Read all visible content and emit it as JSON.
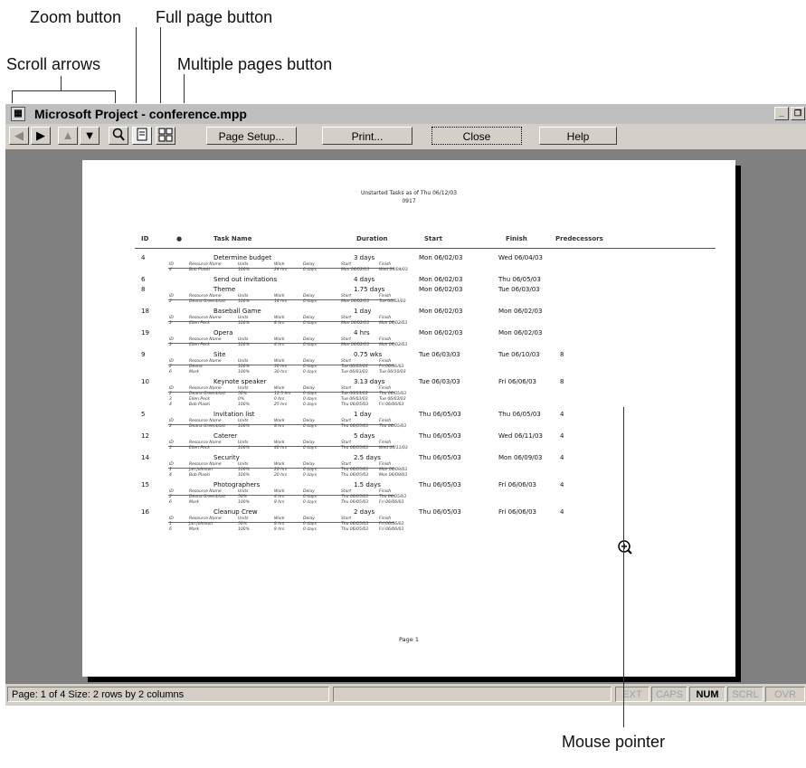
{
  "callouts": {
    "zoom": "Zoom button",
    "full_page": "Full page button",
    "scroll": "Scroll arrows",
    "multiple": "Multiple pages button",
    "mouse": "Mouse pointer"
  },
  "window": {
    "title": "Microsoft Project - conference.mpp",
    "app_icon": "project-icon",
    "controls": [
      "minimize-icon",
      "restore-icon",
      "close-icon"
    ]
  },
  "toolbar": {
    "icons": [
      "scroll-left-icon",
      "scroll-right-icon",
      "scroll-up-icon",
      "scroll-down-icon",
      "zoom-icon",
      "full-page-icon",
      "multiple-pages-icon"
    ],
    "page_setup": "Page Setup...",
    "print": "Print...",
    "close": "Close",
    "help": "Help"
  },
  "report": {
    "title_line1": "Unstarted Tasks as of Thu 06/12/03",
    "title_line2": "0917",
    "headers": {
      "id": "ID",
      "task_name": "Task Name",
      "duration": "Duration",
      "start": "Start",
      "finish": "Finish",
      "predecessors": "Predecessors"
    },
    "sub_headers": [
      "ID",
      "Resource Name",
      "Units",
      "Work",
      "Delay",
      "Start",
      "Finish"
    ],
    "tasks": [
      {
        "id": "4",
        "name": "Determine budget",
        "duration": "3 days",
        "start": "Mon 06/02/03",
        "finish": "Wed 06/04/03",
        "pred": "",
        "assign": [
          [
            "4",
            "Bob Plaski",
            "100%",
            "24 hrs",
            "0 days",
            "Mon 06/02/03",
            "Wed 06/04/03"
          ]
        ]
      },
      {
        "id": "6",
        "name": "Send out invitations",
        "duration": "4 days",
        "start": "Mon 06/02/03",
        "finish": "Thu 06/05/03",
        "pred": "",
        "assign": []
      },
      {
        "id": "8",
        "name": "Theme",
        "duration": "1.75 days",
        "start": "Mon 06/02/03",
        "finish": "Tue 06/03/03",
        "pred": "",
        "assign": [
          [
            "2",
            "Deana Greenblatt",
            "100%",
            "14 hrs",
            "0 days",
            "Mon 06/02/03",
            "Tue 06/03/03"
          ]
        ]
      },
      {
        "id": "18",
        "name": "Baseball Game",
        "duration": "1 day",
        "start": "Mon 06/02/03",
        "finish": "Mon 06/02/03",
        "pred": "",
        "assign": [
          [
            "3",
            "Ellen Peck",
            "100%",
            "8 hrs",
            "0 days",
            "Mon 06/02/03",
            "Mon 06/02/03"
          ]
        ]
      },
      {
        "id": "19",
        "name": "Opera",
        "duration": "4 hrs",
        "start": "Mon 06/02/03",
        "finish": "Mon 06/02/03",
        "pred": "",
        "assign": [
          [
            "3",
            "Ellen Peck",
            "100%",
            "4 hrs",
            "0 days",
            "Mon 06/02/03",
            "Mon 06/02/03"
          ]
        ]
      },
      {
        "id": "9",
        "name": "Site",
        "duration": "0.75 wks",
        "start": "Tue 06/03/03",
        "finish": "Tue 06/10/03",
        "pred": "8",
        "assign": [
          [
            "2",
            "Deana",
            "100%",
            "30 hrs",
            "0 days",
            "Tue 06/03/03",
            "Fri 06/06/03"
          ],
          [
            "6",
            "Mark",
            "100%",
            "30 hrs",
            "0 days",
            "Tue 06/03/03",
            "Tue 06/10/03"
          ]
        ]
      },
      {
        "id": "10",
        "name": "Keynote speaker",
        "duration": "3.13 days",
        "start": "Tue 06/03/03",
        "finish": "Fri 06/06/03",
        "pred": "8",
        "assign": [
          [
            "2",
            "Deana Greenblatt",
            "50%",
            "12.5 hrs",
            "0 days",
            "Tue 06/03/03",
            "Thu 06/05/03"
          ],
          [
            "3",
            "Ellen Peck",
            "0%",
            "0 hrs",
            "0 days",
            "Tue 06/03/03",
            "Tue 06/03/03"
          ],
          [
            "4",
            "Bob Plaski",
            "100%",
            "25 hrs",
            "0 days",
            "Thu 06/05/03",
            "Fri 06/06/03"
          ]
        ]
      },
      {
        "id": "5",
        "name": "Invitation list",
        "duration": "1 day",
        "start": "Thu 06/05/03",
        "finish": "Thu 06/05/03",
        "pred": "4",
        "assign": [
          [
            "2",
            "Deana Greenblatt",
            "100%",
            "8 hrs",
            "0 days",
            "Thu 06/05/03",
            "Thu 06/05/03"
          ]
        ]
      },
      {
        "id": "12",
        "name": "Caterer",
        "duration": "5 days",
        "start": "Thu 06/05/03",
        "finish": "Wed 06/11/03",
        "pred": "4",
        "assign": [
          [
            "3",
            "Ellen Peck",
            "100%",
            "40 hrs",
            "0 days",
            "Thu 06/05/03",
            "Wed 06/11/03"
          ]
        ]
      },
      {
        "id": "14",
        "name": "Security",
        "duration": "2.5 days",
        "start": "Thu 06/05/03",
        "finish": "Mon 06/09/03",
        "pred": "4",
        "assign": [
          [
            "1",
            "Jan Johnson",
            "100%",
            "20 hrs",
            "0 days",
            "Thu 06/05/03",
            "Mon 06/09/03"
          ],
          [
            "4",
            "Bob Plaski",
            "100%",
            "20 hrs",
            "0 days",
            "Thu 06/05/03",
            "Mon 06/09/03"
          ]
        ]
      },
      {
        "id": "15",
        "name": "Photographers",
        "duration": "1.5 days",
        "start": "Thu 06/05/03",
        "finish": "Fri 06/06/03",
        "pred": "4",
        "assign": [
          [
            "2",
            "Deana Greenblatt",
            "50%",
            "4 hrs",
            "0 days",
            "Thu 06/05/03",
            "Thu 06/05/03"
          ],
          [
            "6",
            "Mark",
            "100%",
            "8 hrs",
            "0 days",
            "Thu 06/05/03",
            "Fri 06/06/03"
          ]
        ]
      },
      {
        "id": "16",
        "name": "Cleanup Crew",
        "duration": "2 days",
        "start": "Thu 06/05/03",
        "finish": "Fri 06/06/03",
        "pred": "4",
        "assign": [
          [
            "1",
            "Jan Johnson",
            "50%",
            "8 hrs",
            "0 days",
            "Thu 06/05/03",
            "Fri 06/06/03"
          ],
          [
            "6",
            "Mark",
            "100%",
            "8 hrs",
            "0 days",
            "Thu 06/05/03",
            "Fri 06/06/03"
          ]
        ]
      }
    ],
    "footer": "Page 1"
  },
  "status": {
    "page_info": "Page: 1 of 4   Size: 2 rows by 2 columns",
    "ext": "EXT",
    "caps": "CAPS",
    "num": "NUM",
    "scrl": "SCRL",
    "ovr": "OVR"
  },
  "colors": {
    "chrome": "#d4d0c8",
    "preview_bg": "#808080",
    "title_bar": "#bfbfbf"
  }
}
